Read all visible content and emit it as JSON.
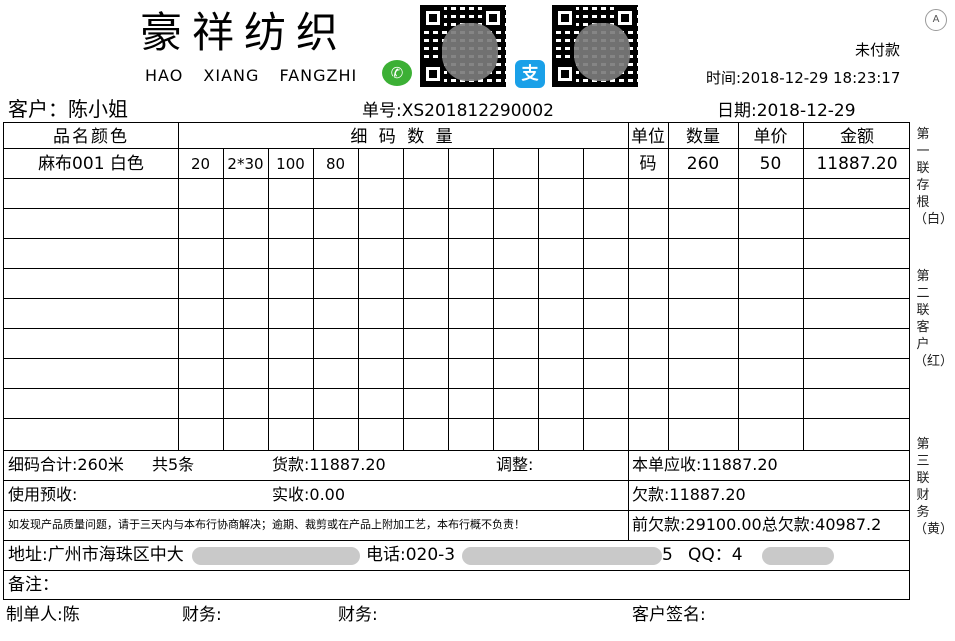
{
  "header": {
    "shop_name_cn": "豪祥纺织",
    "shop_name_en": [
      "HAO",
      "XIANG",
      "FANGZHI"
    ],
    "wechat_icon": "wechat-icon",
    "alipay_icon": "alipay-icon",
    "alipay_glyph": "支",
    "payment_status": "未付款",
    "time_label": "时间:",
    "time_value": "2018-12-29 18:23:17",
    "customer_label": "客户：",
    "customer_name": "陈小姐",
    "order_no_label": "单号:",
    "order_no": "XS201812290002",
    "date_label": "日期:",
    "date_value": "2018-12-29"
  },
  "table": {
    "headers": {
      "product": "品名颜色",
      "sizes": "细 码 数 量",
      "unit": "单位",
      "qty": "数量",
      "price": "单价",
      "amount": "金额"
    },
    "rows": [
      {
        "product": "麻布001 白色",
        "sizes": [
          "20",
          "2*30",
          "100",
          "80",
          "",
          "",
          "",
          "",
          "",
          ""
        ],
        "unit": "码",
        "qty": "260",
        "price": "50",
        "amount": "11887.20"
      }
    ]
  },
  "summary": {
    "size_total": "细码合计:260米",
    "pieces": "共5条",
    "goods_amount": "货款:11887.20",
    "adjust": "调整:",
    "receivable": "本单应收:11887.20",
    "prepaid": "使用预收:",
    "received": "实收:0.00",
    "owed": "欠款:11887.20",
    "notice": "如发现产品质量问题，请于三天内与本布行协商解决；逾期、裁剪或在产品上附加工艺，本布行概不负责！",
    "previous_owed": "前欠款:29100.00",
    "total_owed": "总欠款:40987.2",
    "address_label": "地址:广州市海珠区中大",
    "phone_label": "电话:020-3",
    "phone_tail": "5",
    "qq_label": "QQ：4",
    "remark_label": "备注："
  },
  "footer": {
    "maker": "制单人:陈",
    "finance1": "财务:",
    "finance2": "财务:",
    "customer_sign": "客户签名:"
  },
  "side_labels": {
    "copy1": "第一联存根（白）",
    "copy2": "第二联客户（红）",
    "copy3": "第三联财务（黄）"
  }
}
